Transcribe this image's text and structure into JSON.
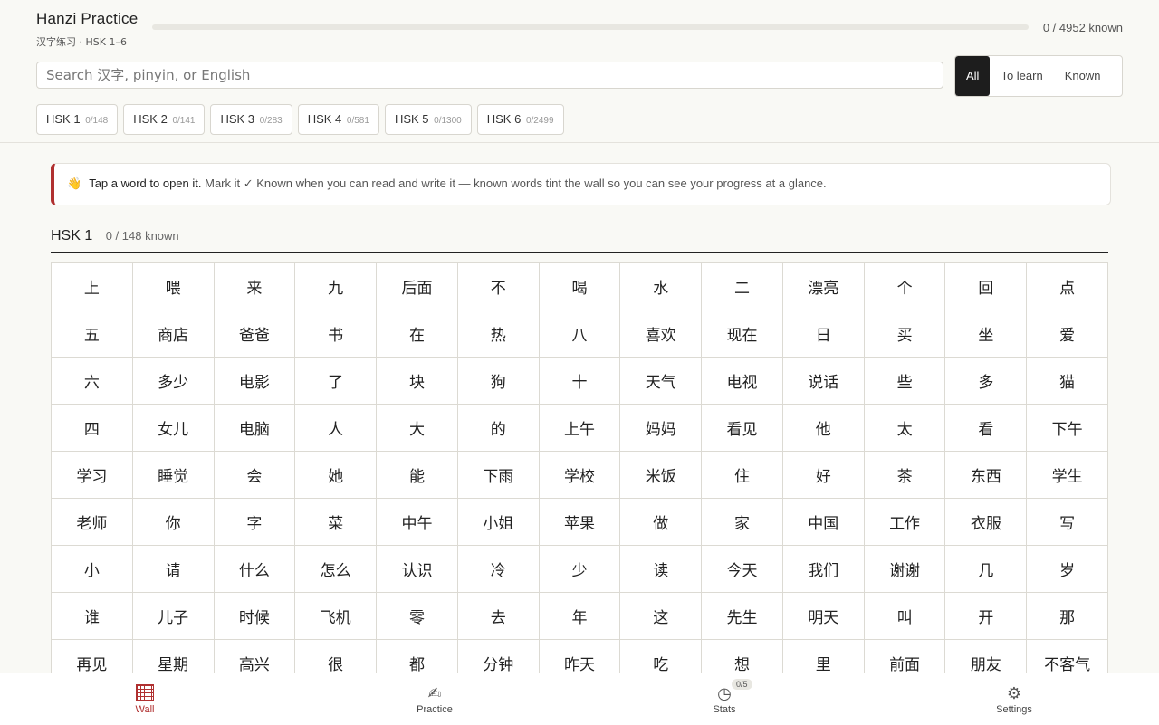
{
  "app": {
    "title": "Hanzi Practice",
    "subtitle": "汉字练习 · HSK 1–6"
  },
  "progress": {
    "label": "0 / 4952 known",
    "known": 0,
    "total": 4952,
    "fraction": 0
  },
  "search": {
    "placeholder": "Search 汉字, pinyin, or English",
    "value": ""
  },
  "filters": {
    "all": "All",
    "to_learn": "To learn",
    "known": "Known",
    "selected": "All"
  },
  "levels": [
    {
      "label": "HSK 1",
      "count": "0/148"
    },
    {
      "label": "HSK 2",
      "count": "0/141"
    },
    {
      "label": "HSK 3",
      "count": "0/283"
    },
    {
      "label": "HSK 4",
      "count": "0/581"
    },
    {
      "label": "HSK 5",
      "count": "0/1300"
    },
    {
      "label": "HSK 6",
      "count": "0/2499"
    }
  ],
  "tip": {
    "emoji": "👋",
    "strong": "Tap a word to open it.",
    "rest": "Mark it ✓ Known when you can read and write it — known words tint the wall so you can see your progress at a glance."
  },
  "section": {
    "title": "HSK 1",
    "count": "0 / 148 known"
  },
  "words": [
    "上",
    "喂",
    "来",
    "九",
    "后面",
    "不",
    "喝",
    "水",
    "二",
    "漂亮",
    "个",
    "回",
    "点",
    "五",
    "商店",
    "爸爸",
    "书",
    "在",
    "热",
    "八",
    "喜欢",
    "现在",
    "日",
    "买",
    "坐",
    "爱",
    "六",
    "多少",
    "电影",
    "了",
    "块",
    "狗",
    "十",
    "天气",
    "电视",
    "说话",
    "些",
    "多",
    "猫",
    "四",
    "女儿",
    "电脑",
    "人",
    "大",
    "的",
    "上午",
    "妈妈",
    "看见",
    "他",
    "太",
    "看",
    "下午",
    "学习",
    "睡觉",
    "会",
    "她",
    "能",
    "下雨",
    "学校",
    "米饭",
    "住",
    "好",
    "茶",
    "东西",
    "学生",
    "老师",
    "你",
    "字",
    "菜",
    "中午",
    "小姐",
    "苹果",
    "做",
    "家",
    "中国",
    "工作",
    "衣服",
    "写",
    "小",
    "请",
    "什么",
    "怎么",
    "认识",
    "冷",
    "少",
    "读",
    "今天",
    "我们",
    "谢谢",
    "几",
    "岁",
    "谁",
    "儿子",
    "时候",
    "飞机",
    "零",
    "去",
    "年",
    "这",
    "先生",
    "明天",
    "叫",
    "开",
    "那",
    "再见",
    "星期",
    "高兴",
    "很",
    "都",
    "分钟",
    "昨天",
    "吃",
    "想",
    "里",
    "前面",
    "朋友",
    "不客气"
  ],
  "nav": {
    "wall": "Wall",
    "practice": "Practice",
    "stats": "Stats",
    "stats_badge": "0/5",
    "settings": "Settings",
    "practice_icon": "✍",
    "stats_icon": "◷",
    "settings_icon": "⚙",
    "active": "Wall"
  },
  "colors": {
    "accent": "#b03030",
    "active_filter_bg": "#1d1d1d",
    "background": "#f9f9f5"
  }
}
